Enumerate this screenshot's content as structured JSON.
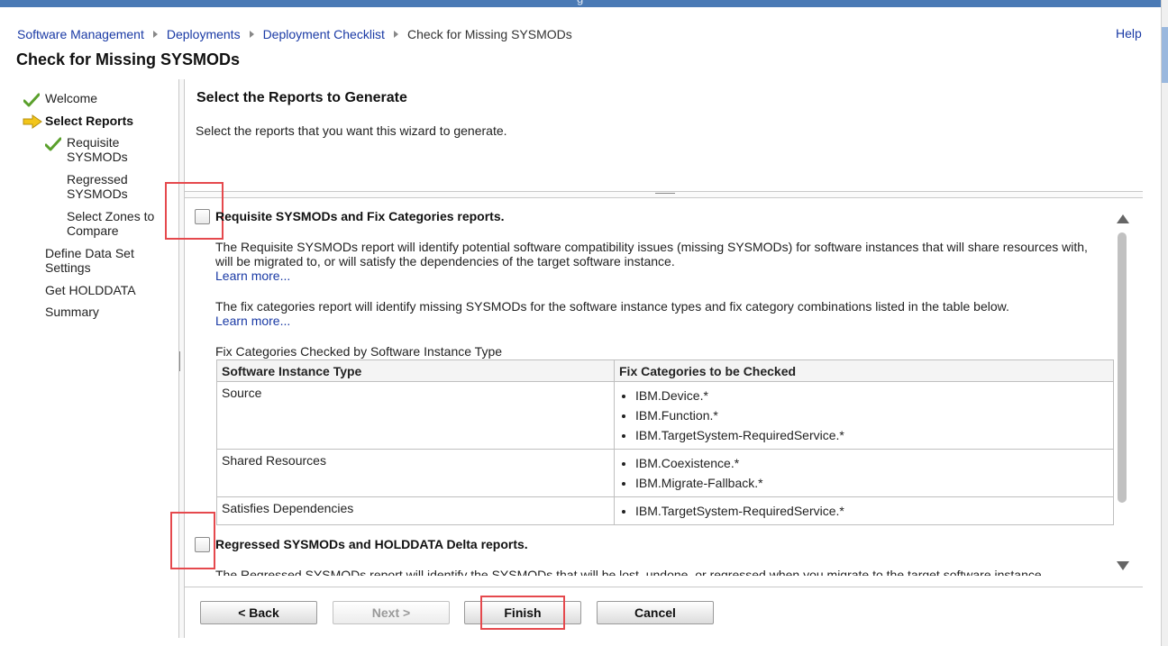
{
  "window": {
    "title_fragment": "g"
  },
  "breadcrumb": {
    "items": [
      "Software Management",
      "Deployments",
      "Deployment Checklist"
    ],
    "current": "Check for Missing SYSMODs"
  },
  "help_label": "Help",
  "page_title": "Check for Missing SYSMODs",
  "nav": {
    "welcome": "Welcome",
    "select_reports": "Select Reports",
    "requisite_1": "Requisite",
    "requisite_2": "SYSMODs",
    "regressed_1": "Regressed",
    "regressed_2": "SYSMODs",
    "zones_1": "Select Zones to",
    "zones_2": "Compare",
    "define_1": "Define Data Set",
    "define_2": "Settings",
    "holddata": "Get HOLDDATA",
    "summary": "Summary"
  },
  "main": {
    "section_title": "Select the Reports to Generate",
    "intro": "Select the reports that you want this wizard to generate.",
    "requisite_option": {
      "label": "Requisite SYSMODs and Fix Categories reports.",
      "checked": false,
      "para1_line1": "The Requisite SYSMODs report will identify potential software compatibility issues (missing SYSMODs) for software instances that will share resources with,",
      "para1_line2": "will be migrated to, or will satisfy the dependencies of the target software instance.",
      "learn_more_1": "Learn more...",
      "para2": "The fix categories report will identify missing SYSMODs for the software instance types and fix category combinations listed in the table below.",
      "learn_more_2": "Learn more..."
    },
    "table": {
      "caption": "Fix Categories Checked by Software Instance Type",
      "headers": [
        "Software Instance Type",
        "Fix Categories to be Checked"
      ],
      "rows": [
        {
          "type": "Source",
          "categories": [
            "IBM.Device.*",
            "IBM.Function.*",
            "IBM.TargetSystem-RequiredService.*"
          ]
        },
        {
          "type": "Shared Resources",
          "categories": [
            "IBM.Coexistence.*",
            "IBM.Migrate-Fallback.*"
          ]
        },
        {
          "type": "Satisfies Dependencies",
          "categories": [
            "IBM.TargetSystem-RequiredService.*"
          ]
        }
      ]
    },
    "regressed_option": {
      "label": "Regressed SYSMODs and HOLDDATA Delta reports.",
      "checked": false,
      "para1": "The Regressed SYSMODs report will identify the SYSMODs that will be lost, undone, or regressed when you migrate to the target software instance."
    }
  },
  "buttons": {
    "back": "< Back",
    "next": "Next >",
    "finish": "Finish",
    "cancel": "Cancel"
  },
  "colors": {
    "link": "#1a3aa5",
    "highlight": "#e5494d",
    "check_green": "#5aa02c",
    "arrow_yellow": "#f2c51a"
  }
}
